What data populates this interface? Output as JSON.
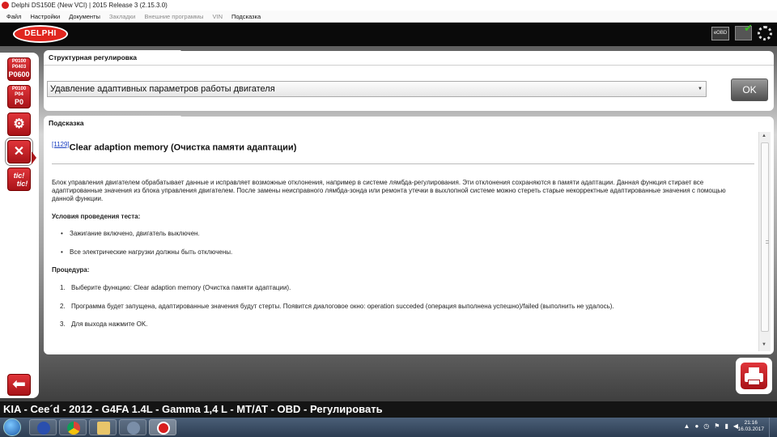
{
  "window": {
    "title": "Delphi DS150E (New VCI) | 2015 Release 3 (2.15.3.0)"
  },
  "menu": [
    {
      "label": "Файл",
      "enabled": true
    },
    {
      "label": "Настройки",
      "enabled": true
    },
    {
      "label": "Документы",
      "enabled": true
    },
    {
      "label": "Закладки",
      "enabled": false
    },
    {
      "label": "Внешние программы",
      "enabled": false
    },
    {
      "label": "VIN",
      "enabled": false
    },
    {
      "label": "Подсказка",
      "enabled": true
    }
  ],
  "brand": {
    "logo_text": "DELPHI",
    "eobd_label": "eOBD"
  },
  "sidebar": {
    "dtc1": {
      "line1": "P0100",
      "line2": "P0403",
      "line3": "P0600"
    },
    "dtc2": {
      "line1": "P0100",
      "line2": "P04",
      "line3": "P0"
    },
    "tic_label_1": "tic!",
    "tic_label_2": "tic!"
  },
  "structural": {
    "tab_label": "Структурная регулировка",
    "selected_function": "Удавление адаптивных параметров работы двигателя",
    "ok_label": "OK"
  },
  "hint": {
    "tab_label": "Подсказка",
    "ref": "[1129]",
    "title": "Clear adaption memory (Очистка памяти адаптации)",
    "description": "Блок управления двигателем обрабатывает данные и исправляет возможные отклонения, например в системе лямбда-регулирования. Эти отклонения сохраняются в памяти адаптации. Данная функция стирает все адаптированные значения из блока управления двигателем. После замены неисправного лямбда-зонда или ремонта утечки в выхлопной системе можно стереть старые некорректные адаптированные значения с помощью данной функции.",
    "conditions_heading": "Условия проведения теста:",
    "conditions": [
      "Зажигание включено, двигатель выключен.",
      "Все электрические нагрузки должны быть отключены."
    ],
    "procedure_heading": "Процедура:",
    "steps": [
      {
        "num": "1.",
        "text": "Выберите функцию: Clear adaption memory (Очистка памяти адаптации)."
      },
      {
        "num": "2.",
        "text": "Программа будет запущена, адаптированные значения будут стерты. Появится диалоговое окно: operation succeded (операция выполнена успешно)/failed (выполнить не удалось)."
      },
      {
        "num": "3.",
        "text": "Для выхода нажмите OK."
      }
    ]
  },
  "status_bar": {
    "vehicle": "KIA - Cee´d - 2012 - G4FA 1.4L - Gamma 1,4 L - MT/AT - OBD - Регулировать"
  },
  "taskbar": {
    "time": "21:16",
    "date": "16.03.2017"
  },
  "colors": {
    "accent_red": "#d81e1e",
    "link_blue": "#1a3fc0",
    "status_bg": "#141414"
  }
}
